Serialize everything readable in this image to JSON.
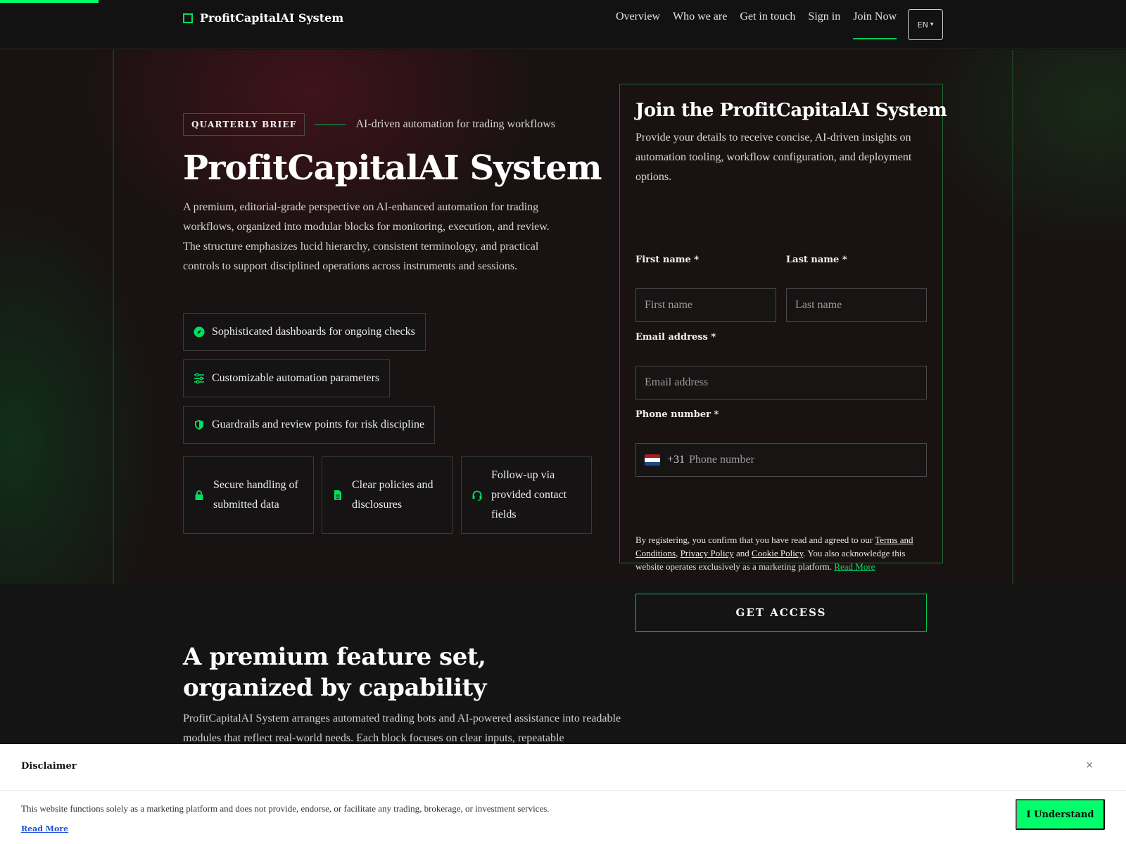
{
  "header": {
    "logo_text": "ProfitCapitalAI System",
    "nav": [
      {
        "label": "Overview"
      },
      {
        "label": "Who we are"
      },
      {
        "label": "Get in touch"
      },
      {
        "label": "Sign in"
      },
      {
        "label": "Join Now",
        "active": true
      }
    ],
    "language": "EN",
    "language_caret": "▾"
  },
  "hero": {
    "tag": "QUARTERLY BRIEF",
    "tagline": "AI-driven automation for trading workflows",
    "title": "ProfitCapitalAI System",
    "description": "A premium, editorial-grade perspective on AI-enhanced automation for trading workflows, organized into modular blocks for monitoring, execution, and review. The structure emphasizes lucid hierarchy, consistent terminology, and practical controls to support disciplined operations across instruments and sessions.",
    "features": [
      {
        "icon": "compass-icon",
        "label": "Sophisticated dashboards for ongoing checks"
      },
      {
        "icon": "sliders-icon",
        "label": "Customizable automation parameters"
      },
      {
        "icon": "shield-icon",
        "label": "Guardrails and review points for risk discipline"
      }
    ],
    "cards": [
      {
        "icon": "lock-icon",
        "label": "Secure handling of submitted data"
      },
      {
        "icon": "document-icon",
        "label": "Clear policies and disclosures"
      },
      {
        "icon": "headset-icon",
        "label": "Follow-up via provided contact fields"
      }
    ]
  },
  "form": {
    "title": "Join the ProfitCapitalAI System",
    "description": "Provide your details to receive concise, AI-driven insights on automation tooling, workflow configuration, and deployment options.",
    "first_name_label": "First name *",
    "first_name_placeholder": "First name",
    "last_name_label": "Last name *",
    "last_name_placeholder": "Last name",
    "email_label": "Email address *",
    "email_placeholder": "Email address",
    "phone_label": "Phone number *",
    "phone_prefix": "+31",
    "phone_placeholder": "Phone number",
    "legal": {
      "text_1": "By registering, you confirm that you have read and agreed to our ",
      "terms": "Terms and Conditions",
      "sep_1": ", ",
      "privacy": "Privacy Policy",
      "sep_2": " and ",
      "cookie": "Cookie Policy",
      "text_2": ". You also acknowledge this website operates exclusively as a marketing platform. ",
      "read_more": "Read More"
    },
    "submit_label": "GET ACCESS"
  },
  "features_section": {
    "title": "A premium feature set, organized by capability",
    "description": "ProfitCapitalAI System arranges automated trading bots and AI-powered assistance into readable modules that reflect real-world needs. Each block focuses on clear inputs, repeatable"
  },
  "disclaimer": {
    "title": "Disclaimer",
    "close": "×",
    "text": "This website functions solely as a marketing platform and does not provide, endorse, or facilitate any trading, brokerage, or investment services.",
    "read_more": "Read More",
    "button": "I Understand"
  },
  "colors": {
    "accent": "#00ff6a",
    "background": "#141414",
    "border_green": "#00c853",
    "link_blue": "#1a4fd8"
  }
}
